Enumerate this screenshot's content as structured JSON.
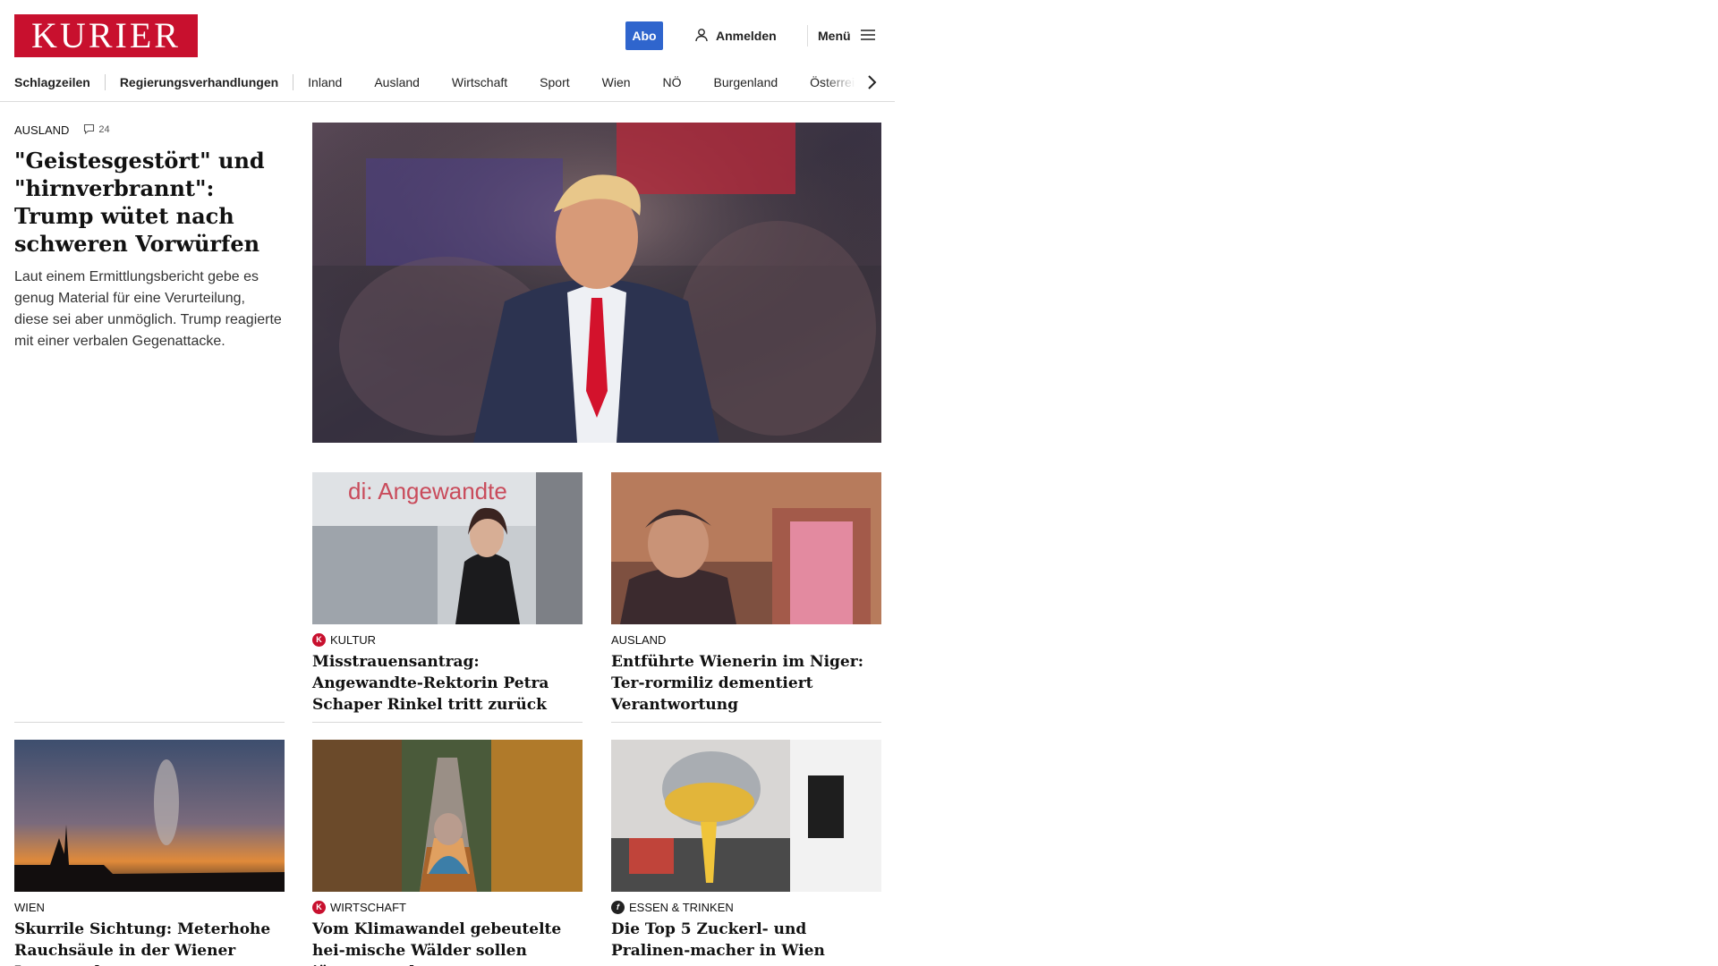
{
  "header": {
    "logo": "KURIER",
    "abo": "Abo",
    "login": "Anmelden",
    "menu": "Menü",
    "brand_color": "#c8102e",
    "accent_color": "#2f65cd"
  },
  "nav": {
    "items": [
      "Schlagzeilen",
      "Regierungsverhandlungen",
      "Inland",
      "Ausland",
      "Wirtschaft",
      "Sport",
      "Wien",
      "NÖ",
      "Burgenland",
      "Österreich"
    ]
  },
  "lead": {
    "category": "AUSLAND",
    "comments": "24",
    "title": "\"Geistesgestört\" und \"hirnverbrannt\": Trump wütet nach schweren Vorwürfen",
    "teaser": "Laut einem Ermittlungsbericht gebe es genug Material für eine Verurteilung, diese sei aber unmöglich. Trump reagierte mit einer verbalen Gegenattacke."
  },
  "cards": [
    {
      "badge": "K",
      "category": "KULTUR",
      "title": "Misstrauensantrag: Angewandte-Rektorin Petra Schaper Rinkel tritt zurück",
      "image_text": "di: Angewandte"
    },
    {
      "badge": "",
      "category": "AUSLAND",
      "title": "Entführte Wienerin im Niger: Ter-rormiliz dementiert Verantwortung"
    },
    {
      "badge": "",
      "category": "WIEN",
      "title": "Skurrile Sichtung: Meterhohe Rauchsäule in der Wiener Innenstadt"
    },
    {
      "badge": "K",
      "category": "WIRTSCHAFT",
      "title": "Vom Klimawandel gebeutelte hei-mische Wälder sollen jünger werden"
    },
    {
      "badge": "f",
      "category": "ESSEN & TRINKEN",
      "title": "Die Top 5 Zuckerl- und Pralinen-macher in Wien"
    }
  ]
}
